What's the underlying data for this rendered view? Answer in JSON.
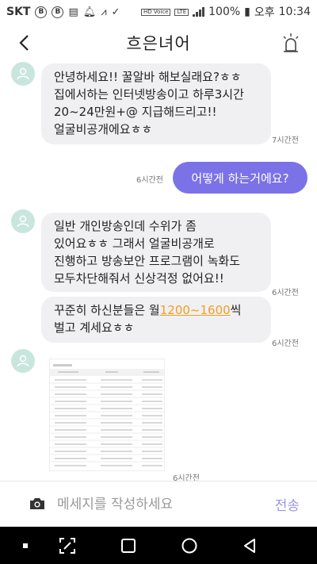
{
  "status_bar": {
    "carrier": "SKT",
    "badge1": "B",
    "badge2": "B",
    "volte_label": "HD Voice",
    "lte_label": "LTE",
    "battery": "100%",
    "ampm": "오후",
    "clock": "10:34"
  },
  "header": {
    "title": "흐은녀어",
    "back_icon": "back-arrow-icon",
    "alarm_icon": "siren-icon"
  },
  "messages": [
    {
      "type": "incoming",
      "lines": [
        "안녕하세요!! 꿀알바 해보실래요?ㅎㅎ",
        "집에서하는 인터넷방송이고 하루3시간",
        "20~24만원+@ 지급해드리고!!",
        "얼굴비공개에요ㅎㅎ"
      ],
      "time": "7시간전"
    },
    {
      "type": "outgoing",
      "text": "어떻게 하는거에요?",
      "time": "6시간전"
    },
    {
      "type": "incoming",
      "lines": [
        "일반 개인방송인데 수위가 좀",
        "있어요ㅎㅎ 그래서 얼굴비공개로",
        "진행하고 방송보안 프로그램이 녹화도",
        "모두차단해줘서 신상걱정 없어요!!"
      ],
      "time": "6시간전"
    },
    {
      "type": "incoming",
      "line1_prefix": "꾸준히 하신분들은 월",
      "line1_highlight": "1200~1600",
      "line1_suffix": "씩",
      "line2": "벌고 계세요ㅎㅎ",
      "time": "6시간전"
    },
    {
      "type": "image",
      "time": "6시간전"
    }
  ],
  "composer": {
    "placeholder": "메세지를 작성하세요",
    "send_label": "전송",
    "camera_icon": "camera-icon"
  },
  "colors": {
    "accent": "#7b72e8",
    "incoming_bubble": "#f0f0f2",
    "highlight": "#f0a020",
    "avatar": "#c9e6de"
  }
}
